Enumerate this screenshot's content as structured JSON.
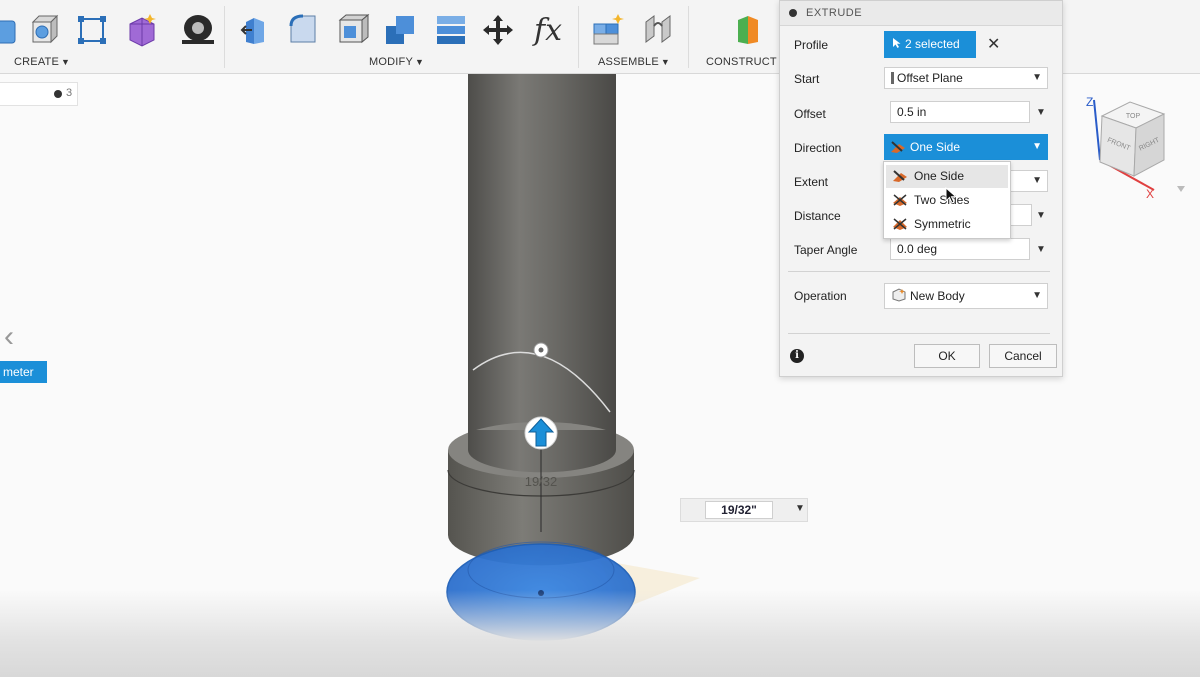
{
  "toolbar": {
    "groups": [
      {
        "label": "CREATE"
      },
      {
        "label": "MODIFY"
      },
      {
        "label": "ASSEMBLE"
      },
      {
        "label": "CONSTRUCT"
      }
    ],
    "icons": {
      "create": [
        "box-icon",
        "sketch-rectangle-icon",
        "form-icon",
        "coil-icon"
      ],
      "modify": [
        "press-pull-icon",
        "fillet-icon",
        "shell-icon",
        "combine-icon",
        "offset-face-icon",
        "move-icon",
        "parameters-icon"
      ],
      "assemble": [
        "new-component-icon",
        "joint-icon"
      ],
      "construct": [
        "plane-icon"
      ]
    },
    "parameters_glyph": "fx"
  },
  "browser": {
    "counter": "3"
  },
  "left_tag": {
    "text": "meter"
  },
  "viewport": {
    "dimension_label": "19/32",
    "dimension_input": "19/32\""
  },
  "dialog": {
    "title": "EXTRUDE",
    "rows": {
      "profile": {
        "label": "Profile",
        "value": "2 selected"
      },
      "start": {
        "label": "Start",
        "value": "Offset Plane"
      },
      "offset": {
        "label": "Offset",
        "value": "0.5 in"
      },
      "direction": {
        "label": "Direction",
        "value": "One Side"
      },
      "extent": {
        "label": "Extent"
      },
      "distance": {
        "label": "Distance"
      },
      "taper": {
        "label": "Taper Angle",
        "value": "0.0 deg"
      },
      "operation": {
        "label": "Operation",
        "value": "New Body"
      }
    },
    "ok_label": "OK",
    "cancel_label": "Cancel"
  },
  "direction_menu": {
    "items": [
      {
        "label": "One Side"
      },
      {
        "label": "Two Sides"
      },
      {
        "label": "Symmetric"
      }
    ],
    "highlighted": "One Side"
  },
  "viewcube": {
    "faces": [
      "TOP",
      "FRONT",
      "RIGHT"
    ],
    "axes": [
      "Z",
      "X"
    ]
  },
  "colors": {
    "accent": "#1b8fd8",
    "body_gray": "#6b6a66",
    "profile_blue": "#2f76d6"
  }
}
